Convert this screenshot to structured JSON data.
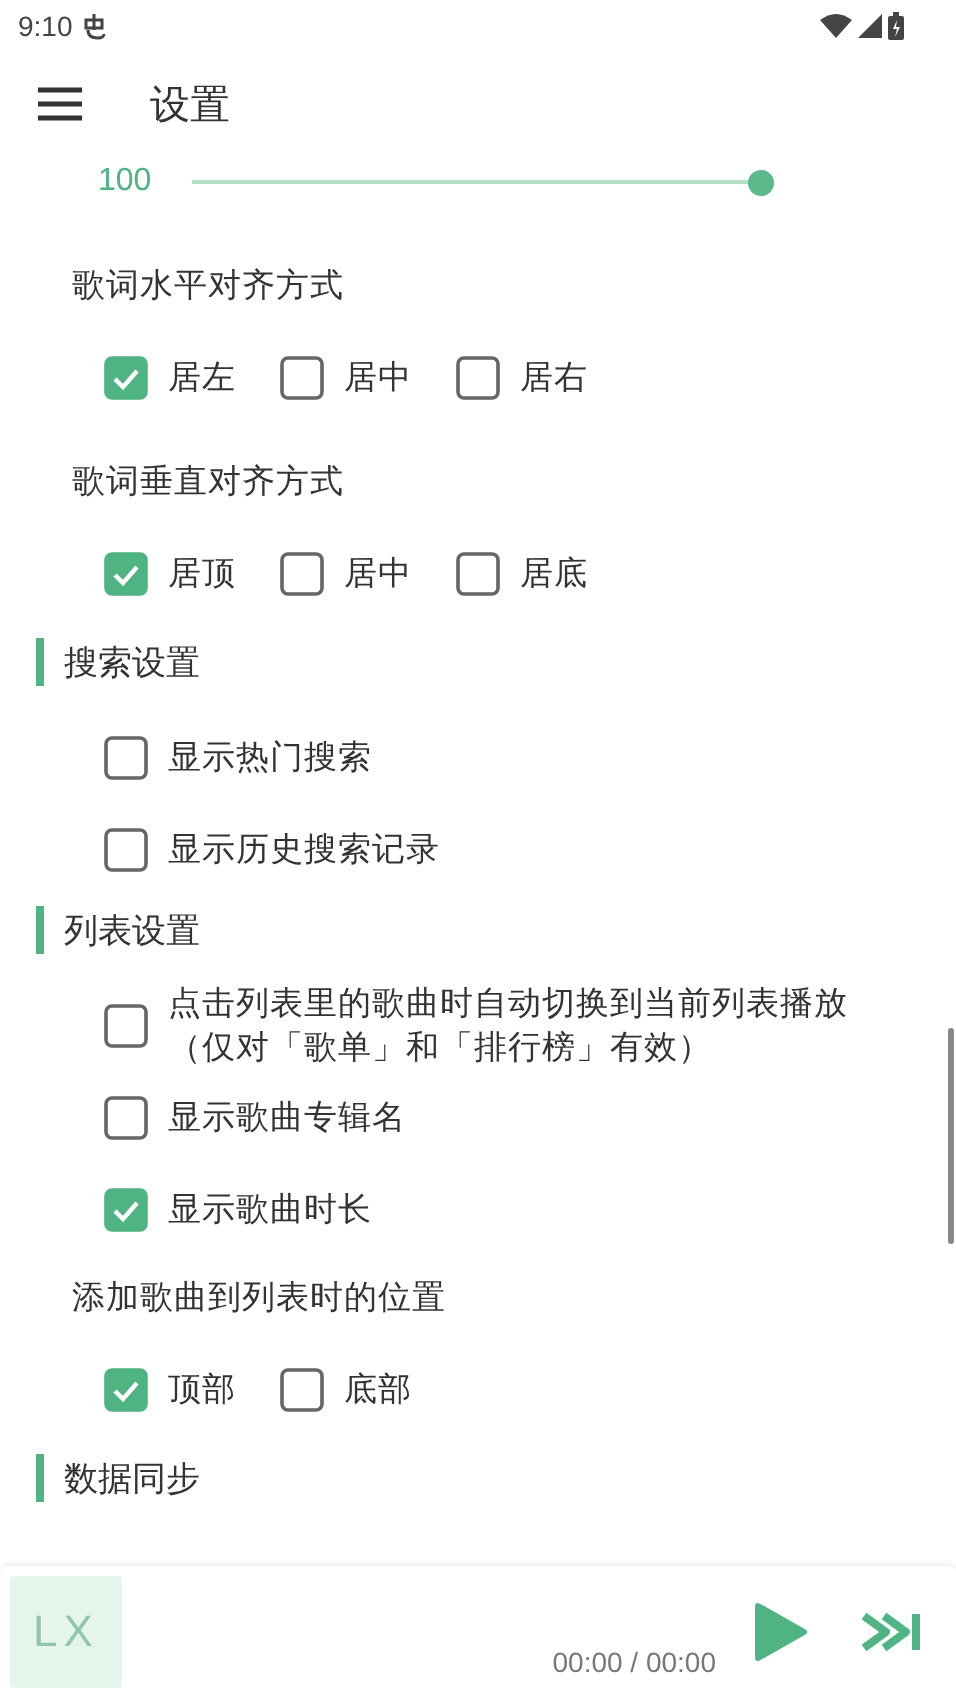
{
  "status_bar": {
    "time": "9:10"
  },
  "header": {
    "title": "设置"
  },
  "slider": {
    "reading": "100",
    "level": 1.0
  },
  "items": [
    {
      "kind": "option_group",
      "label": "歌词水平对齐方式",
      "options": [
        {
          "label": "居左",
          "selected": true
        },
        {
          "label": "居中",
          "selected": false
        },
        {
          "label": "居右",
          "selected": false
        }
      ]
    },
    {
      "kind": "option_group",
      "label": "歌词垂直对齐方式",
      "options": [
        {
          "label": "居顶",
          "selected": true
        },
        {
          "label": "居中",
          "selected": false
        },
        {
          "label": "居底",
          "selected": false
        }
      ]
    },
    {
      "kind": "section",
      "title": "搜索设置"
    },
    {
      "kind": "checkbox",
      "label": "显示热门搜索",
      "checked": false
    },
    {
      "kind": "checkbox",
      "label": "显示历史搜索记录",
      "checked": false
    },
    {
      "kind": "section",
      "title": "列表设置"
    },
    {
      "kind": "checkbox",
      "label": "点击列表里的歌曲时自动切换到当前列表播放（仅对「歌单」和「排行榜」有效）",
      "checked": false
    },
    {
      "kind": "checkbox",
      "label": "显示歌曲专辑名",
      "checked": false
    },
    {
      "kind": "checkbox",
      "label": "显示歌曲时长",
      "checked": true
    },
    {
      "kind": "option_group",
      "label": "添加歌曲到列表时的位置",
      "options": [
        {
          "label": "顶部",
          "selected": true
        },
        {
          "label": "底部",
          "selected": false
        }
      ]
    },
    {
      "kind": "section",
      "title": "数据同步"
    }
  ],
  "player": {
    "logo": "LX",
    "time": "00:00 / 00:00"
  }
}
